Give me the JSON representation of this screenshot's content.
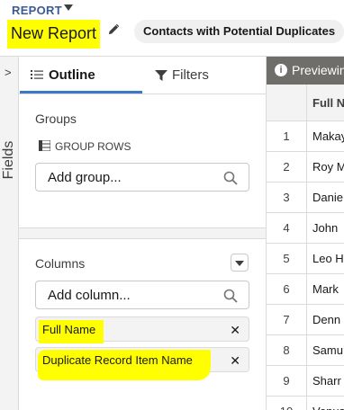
{
  "header": {
    "report_label": "REPORT",
    "title": "New Report",
    "report_type": "Contacts with Potential Duplicates"
  },
  "fields_rail": {
    "label": "Fields",
    "chevron": "chevron-right-icon"
  },
  "tabs": [
    {
      "label": "Outline",
      "icon": "list-icon",
      "active": true
    },
    {
      "label": "Filters",
      "icon": "funnel-icon",
      "active": false
    }
  ],
  "groups": {
    "title": "Groups",
    "group_rows_label": "GROUP ROWS",
    "add_placeholder": "Add group..."
  },
  "columns": {
    "title": "Columns",
    "add_placeholder": "Add column...",
    "items": [
      "Full Name",
      "Duplicate Record Item Name"
    ]
  },
  "preview": {
    "banner": "Previewing",
    "column_header": "Full N",
    "rows": [
      {
        "num": "1",
        "name": "Makay"
      },
      {
        "num": "2",
        "name": "Roy M"
      },
      {
        "num": "3",
        "name": "Danie"
      },
      {
        "num": "4",
        "name": "John"
      },
      {
        "num": "5",
        "name": "Leo H"
      },
      {
        "num": "6",
        "name": "Mark"
      },
      {
        "num": "7",
        "name": "Denn"
      },
      {
        "num": "8",
        "name": "Samu"
      },
      {
        "num": "9",
        "name": "Sharr"
      },
      {
        "num": "10",
        "name": "Venus"
      }
    ]
  },
  "colors": {
    "highlight": "#ffff00",
    "accent": "#3b78c6",
    "preview_bar": "#706e6b"
  }
}
